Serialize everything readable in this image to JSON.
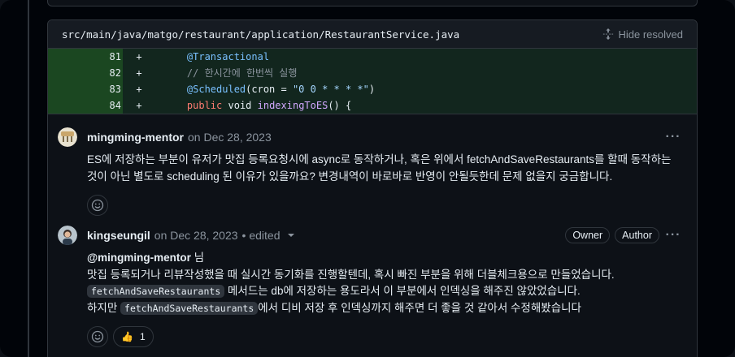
{
  "file": {
    "path": "src/main/java/matgo/restaurant/application/RestaurantService.java",
    "hide_resolved_label": "Hide resolved",
    "hide_resolved_icon": "unfold-icon"
  },
  "diff": {
    "rows": [
      {
        "line": "81",
        "sign": "+",
        "code": "@Transactional"
      },
      {
        "line": "82",
        "sign": "+",
        "code": "// 한시간에 한번씩 실행"
      },
      {
        "line": "83",
        "sign": "+",
        "code": "@Scheduled(cron = \"0 0 * * * *\")"
      },
      {
        "line": "84",
        "sign": "+",
        "code": "public void indexingToES() {"
      }
    ],
    "code_pieces": {
      "r1_annot": "@Transactional",
      "r2_comment": "// 한시간에 한번씩 실행",
      "r3_annot": "@Scheduled",
      "r3_mid": "(cron = ",
      "r3_str": "\"0 0 * * * *\"",
      "r3_end": ")",
      "r4_kw": "public",
      "r4_type": " void ",
      "r4_fn": "indexingToES",
      "r4_end": "() {"
    }
  },
  "comments": [
    {
      "author": "mingming-mentor",
      "date": "on Dec 28, 2023",
      "body": "ES에 저장하는 부분이 유저가 맛집 등록요청시에 async로 동작하거나, 혹은 위에서 fetchAndSaveRestaurants를 할때 동작하는 것이 아닌 별도로 scheduling 된 이유가 있을까요? 변경내역이 바로바로 반영이 안될듯한데 문제 없을지 궁금합니다.",
      "more_icon": "kebab-horizontal-icon",
      "emoji_icon": "smiley-icon"
    },
    {
      "author": "kingseungil",
      "date": "on Dec 28, 2023",
      "edited": "• edited",
      "badges": [
        "Owner",
        "Author"
      ],
      "mention": "@mingming-mentor",
      "mention_suffix": " 님",
      "line2": "맛집 등록되거나 리뷰작성했을 때 실시간 동기화를 진행할텐데, 혹시 빠진 부분을 위해 더블체크용으로 만들었습니다.",
      "line3_chip": "fetchAndSaveRestaurants",
      "line3_text": " 메서드는 db에 저장하는 용도라서 이 부분에서 인덱싱을 해주진 않았었습니다.",
      "line4_prefix": "하지만 ",
      "line4_chip": "fetchAndSaveRestaurants",
      "line4_text": "에서 디비 저장 후 인덱싱까지 해주면 더 좋을 것 같아서 수정해봤습니다",
      "reaction_emoji": "👍",
      "reaction_count": "1",
      "more_icon": "kebab-horizontal-icon",
      "emoji_icon": "smiley-icon"
    }
  ],
  "colors": {
    "background": "#0d1117",
    "diff_added_bg": "#12261e",
    "diff_added_num_bg": "#1b4721",
    "border": "#30363d",
    "muted": "#8b949e"
  }
}
